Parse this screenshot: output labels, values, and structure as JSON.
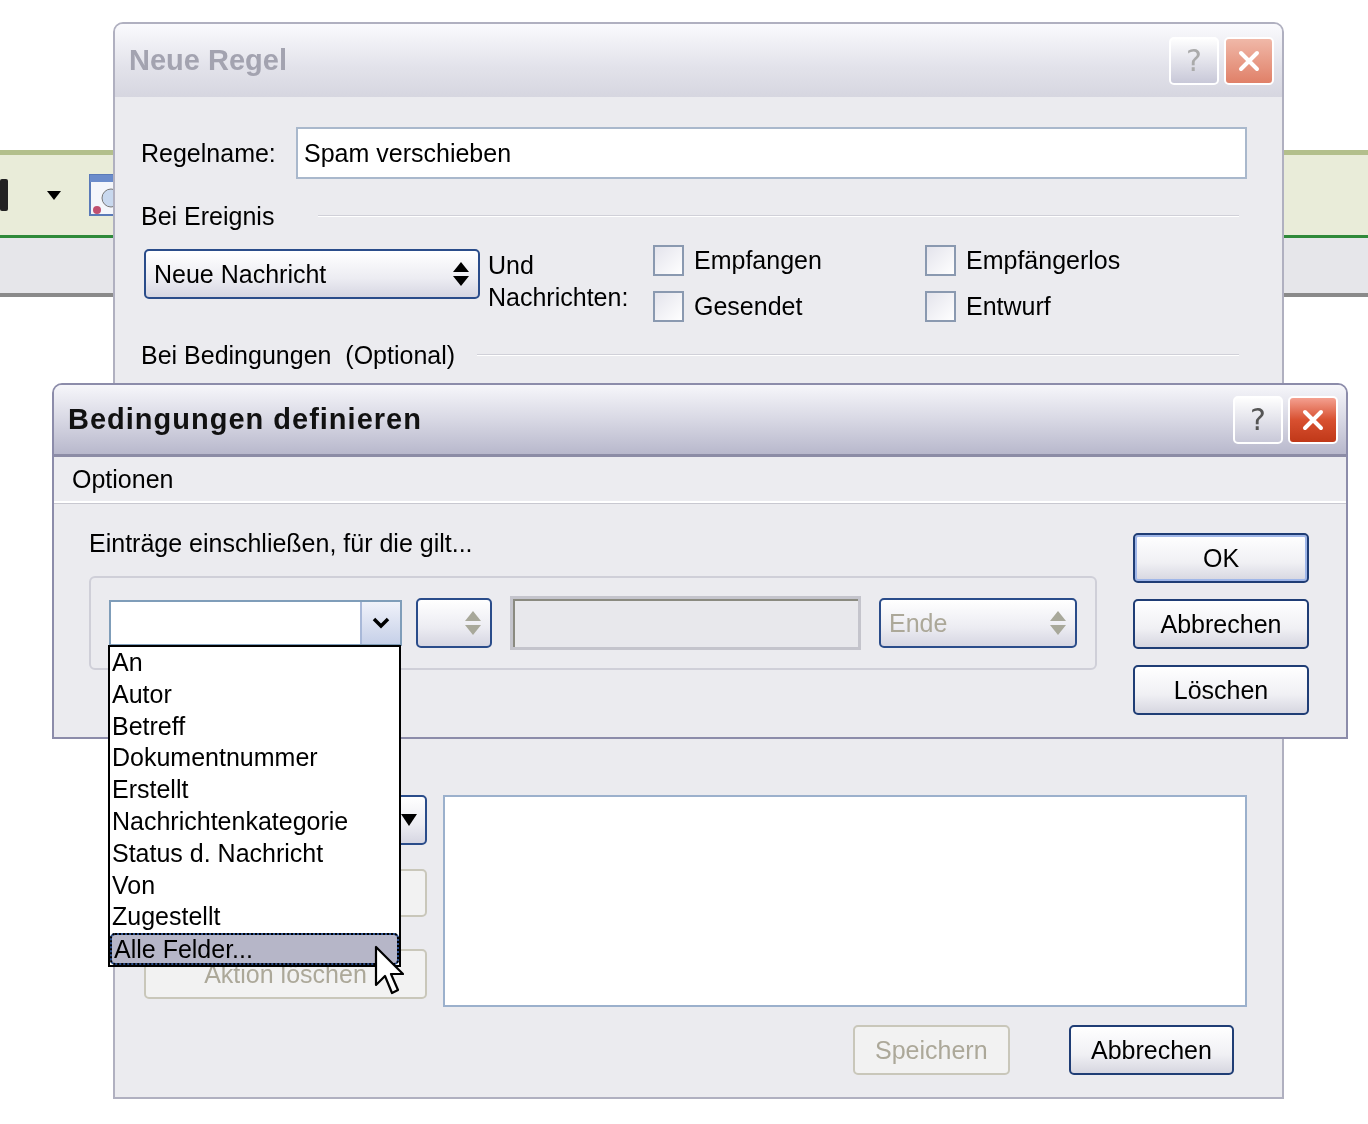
{
  "rule_dialog": {
    "title": "Neue Regel",
    "active": false,
    "help_button": "?",
    "name_label": "Regelname:",
    "name_value": "Spam verschieben",
    "event_heading": "Bei Ereignis",
    "event_select": "Neue Nachricht",
    "messages_label": "Und Nachrichten:",
    "message_types": [
      {
        "label": "Empfangen",
        "checked": false
      },
      {
        "label": "Empfängerlos",
        "checked": false
      },
      {
        "label": "Gesendet",
        "checked": false
      },
      {
        "label": "Entwurf",
        "checked": false
      }
    ],
    "conditions_heading": "Bei Bedingungen  (Optional)",
    "delete_action_button": {
      "label": "Aktion löschen",
      "disabled": true
    },
    "save_button": {
      "label": "Speichern",
      "disabled": true
    },
    "cancel_button": {
      "label": "Abbrechen",
      "disabled": false
    }
  },
  "conditions_dialog": {
    "title": "Bedingungen definieren",
    "active": true,
    "help_button": "?",
    "menu": [
      "Optionen"
    ],
    "instruction": "Einträge einschließen, für die gilt...",
    "field_select": {
      "expanded": true
    },
    "value_field": {
      "disabled": true
    },
    "end_select": {
      "value": "Ende",
      "disabled": true
    },
    "buttons": [
      {
        "label": "OK",
        "default": true
      },
      {
        "label": "Abbrechen",
        "default": false
      },
      {
        "label": "Löschen",
        "default": false
      }
    ],
    "field_list": [
      {
        "label": "An",
        "selected": false
      },
      {
        "label": "Autor",
        "selected": false
      },
      {
        "label": "Betreff",
        "selected": false
      },
      {
        "label": "Dokumentnummer",
        "selected": false
      },
      {
        "label": "Erstellt",
        "selected": false
      },
      {
        "label": "Nachrichtenkategorie",
        "selected": false
      },
      {
        "label": "Status d. Nachricht",
        "selected": false
      },
      {
        "label": "Von",
        "selected": false
      },
      {
        "label": "Zugestellt",
        "selected": false
      },
      {
        "label": "Alle Felder...",
        "selected": true
      }
    ]
  }
}
